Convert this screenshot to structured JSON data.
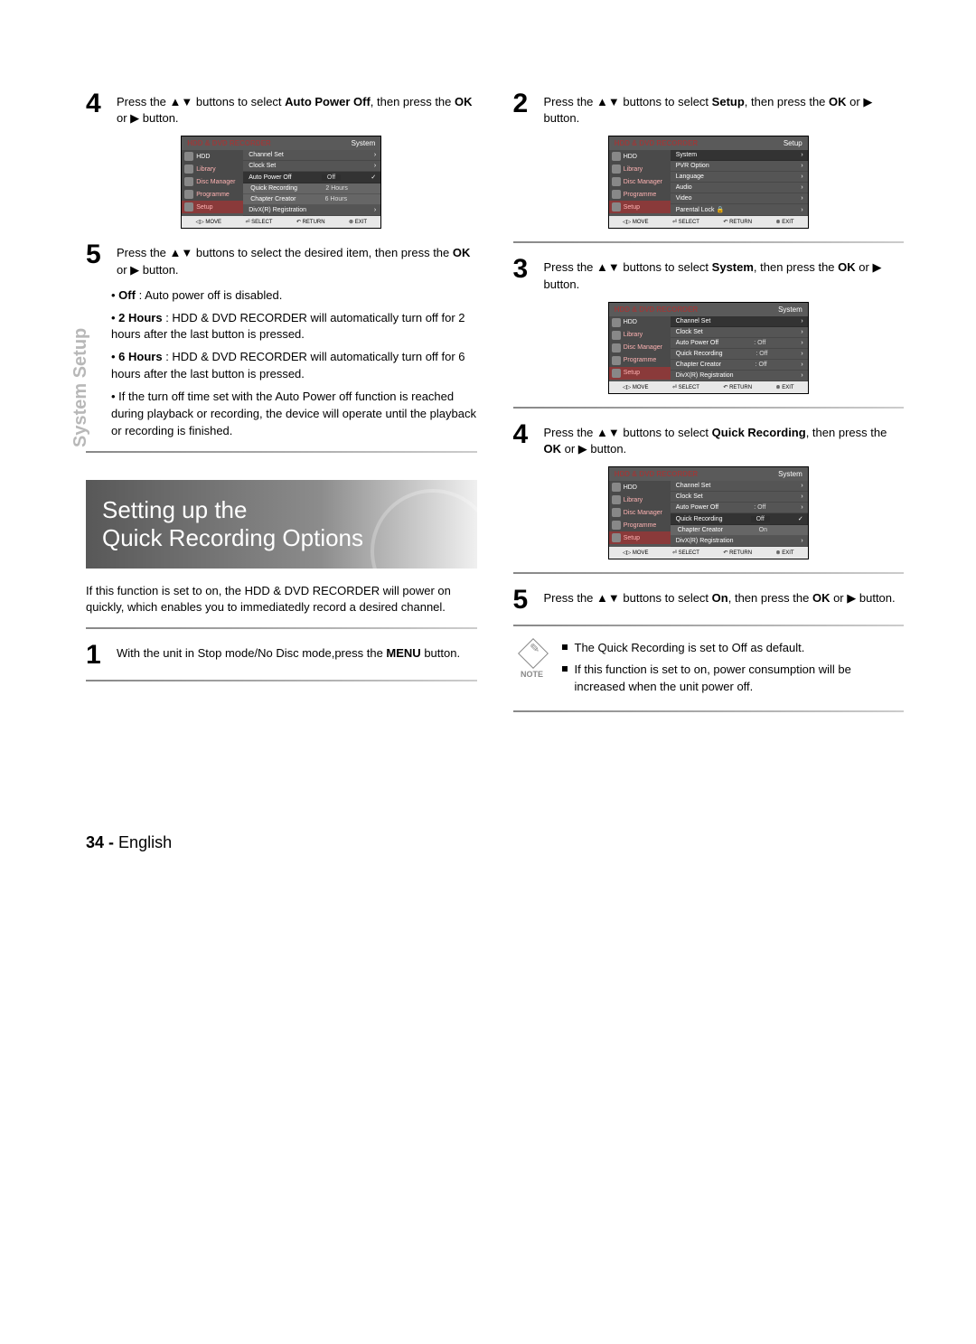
{
  "sideTab": "System Setup",
  "left": {
    "step4": {
      "num": "4",
      "textA": "Press the ",
      "textB": " buttons to select ",
      "bold1": "Auto Power Off",
      "textC": ", then press the ",
      "bold2": "OK",
      "textD": " or ",
      "textE": " button."
    },
    "osd1": {
      "hdrL": "HDD & DVD RECORDER",
      "hdrR": "System",
      "side": [
        "HDD",
        "Library",
        "Disc Manager",
        "Programme",
        "Setup"
      ],
      "rows": [
        {
          "l": "Channel Set",
          "r": "",
          "c": "›"
        },
        {
          "l": "Clock Set",
          "r": "",
          "c": "›"
        },
        {
          "l": "Auto Power Off",
          "r": "Off",
          "c": "✓",
          "hl": true
        },
        {
          "l": "Quick Recording",
          "r": "2 Hours",
          "c": "",
          "sub": true
        },
        {
          "l": "Chapter Creator",
          "r": "6 Hours",
          "c": "",
          "sub": true
        },
        {
          "l": "DivX(R) Registration",
          "r": "",
          "c": "›"
        }
      ],
      "ft": [
        "◁▷ MOVE",
        "⏎ SELECT",
        "↶ RETURN",
        "⊗ EXIT"
      ]
    },
    "step5": {
      "num": "5",
      "textA": "Press the ",
      "textB": " buttons to select the desired item, then press the ",
      "bold": "OK",
      "textC": " or ",
      "textD": " button."
    },
    "bullets": [
      {
        "b": "Off",
        "t": " : Auto power off is disabled."
      },
      {
        "b": "2 Hours",
        "t": " : HDD & DVD RECORDER will automatically turn off for 2 hours after the last button is pressed."
      },
      {
        "b": "6 Hours",
        "t": " : HDD & DVD RECORDER will automatically turn off for 6 hours after the last button is pressed."
      }
    ],
    "bulletsNote": "If the turn off time set with the Auto Power off function is reached during playback or recording, the device will operate until the playback or recording is finished.",
    "banner": {
      "l1": "Setting up the",
      "l2": "Quick Recording Options"
    },
    "intro": "If this function is set to on, the HDD & DVD RECORDER will power on quickly, which enables you to immediatedly record a desired channel.",
    "step1": {
      "num": "1",
      "textA": "With the unit in Stop mode/No Disc mode,press the ",
      "bold": "MENU",
      "textB": " button."
    }
  },
  "right": {
    "step2": {
      "num": "2",
      "textA": "Press the ",
      "textB": " buttons to select ",
      "bold1": "Setup",
      "textC": ", then press the ",
      "bold2": "OK",
      "textD": " or ",
      "textE": " button."
    },
    "osd2": {
      "hdrL": "HDD & DVD RECORDER",
      "hdrR": "Setup",
      "side": [
        "HDD",
        "Library",
        "Disc Manager",
        "Programme",
        "Setup"
      ],
      "rows": [
        {
          "l": "System",
          "r": "",
          "c": "›",
          "hl": true
        },
        {
          "l": "PVR Option",
          "r": "",
          "c": "›"
        },
        {
          "l": "Language",
          "r": "",
          "c": "›"
        },
        {
          "l": "Audio",
          "r": "",
          "c": "›"
        },
        {
          "l": "Video",
          "r": "",
          "c": "›"
        },
        {
          "l": "Parental Lock 🔒",
          "r": "",
          "c": "›"
        }
      ],
      "ft": [
        "◁▷ MOVE",
        "⏎ SELECT",
        "↶ RETURN",
        "⊗ EXIT"
      ]
    },
    "step3": {
      "num": "3",
      "textA": "Press the ",
      "textB": " buttons to select ",
      "bold1": "System",
      "textC": ", then press the ",
      "bold2": "OK",
      "textD": " or ",
      "textE": " button."
    },
    "osd3": {
      "hdrL": "HDD & DVD RECORDER",
      "hdrR": "System",
      "side": [
        "HDD",
        "Library",
        "Disc Manager",
        "Programme",
        "Setup"
      ],
      "rows": [
        {
          "l": "Channel Set",
          "r": "",
          "c": "›",
          "hl": true
        },
        {
          "l": "Clock Set",
          "r": "",
          "c": "›"
        },
        {
          "l": "Auto Power Off",
          "r": ": Off",
          "c": "›"
        },
        {
          "l": "Quick Recording",
          "r": ": Off",
          "c": "›"
        },
        {
          "l": "Chapter Creator",
          "r": ": Off",
          "c": "›"
        },
        {
          "l": "DivX(R) Registration",
          "r": "",
          "c": "›"
        }
      ],
      "ft": [
        "◁▷ MOVE",
        "⏎ SELECT",
        "↶ RETURN",
        "⊗ EXIT"
      ]
    },
    "step4": {
      "num": "4",
      "textA": "Press the ",
      "textB": " buttons to select ",
      "bold1": "Quick Recording",
      "textC": ", then press the ",
      "bold2": "OK",
      "textD": " or ",
      "textE": " button."
    },
    "osd4": {
      "hdrL": "HDD & DVD RECORDER",
      "hdrR": "System",
      "side": [
        "HDD",
        "Library",
        "Disc Manager",
        "Programme",
        "Setup"
      ],
      "rows": [
        {
          "l": "Channel Set",
          "r": "",
          "c": "›"
        },
        {
          "l": "Clock Set",
          "r": "",
          "c": "›"
        },
        {
          "l": "Auto Power Off",
          "r": ": Off",
          "c": "›"
        },
        {
          "l": "Quick Recording",
          "r": "Off",
          "c": "✓",
          "hl": true
        },
        {
          "l": "Chapter Creator",
          "r": "On",
          "c": "",
          "sub": true
        },
        {
          "l": "DivX(R) Registration",
          "r": "",
          "c": "›"
        }
      ],
      "ft": [
        "◁▷ MOVE",
        "⏎ SELECT",
        "↶ RETURN",
        "⊗ EXIT"
      ]
    },
    "step5": {
      "num": "5",
      "textA": "Press the ",
      "textB": " buttons to select ",
      "bold1": "On",
      "textC": ", then press the ",
      "bold2": "OK",
      "textD": " or ",
      "textE": " button."
    },
    "noteLabel": "NOTE",
    "notes": [
      "The Quick Recording is set to Off as default.",
      "If this function is set to on, power consumption will be increased when the unit power off."
    ]
  },
  "footer": {
    "num": "34 -",
    "lang": "English"
  }
}
